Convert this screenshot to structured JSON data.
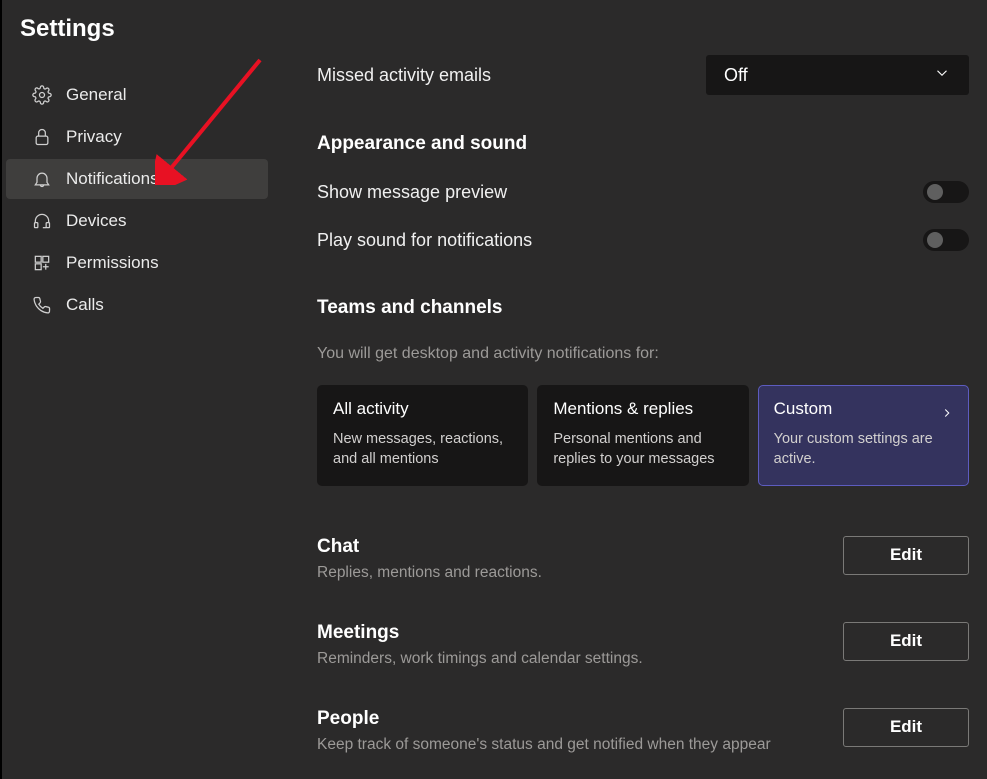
{
  "title": "Settings",
  "sidebar": {
    "items": [
      {
        "label": "General",
        "icon": "gear-icon"
      },
      {
        "label": "Privacy",
        "icon": "lock-icon"
      },
      {
        "label": "Notifications",
        "icon": "bell-icon"
      },
      {
        "label": "Devices",
        "icon": "headset-icon"
      },
      {
        "label": "Permissions",
        "icon": "apps-icon"
      },
      {
        "label": "Calls",
        "icon": "phone-icon"
      }
    ],
    "selected_index": 2
  },
  "content": {
    "missed_emails": {
      "label": "Missed activity emails",
      "value": "Off"
    },
    "appearance": {
      "heading": "Appearance and sound",
      "preview_label": "Show message preview",
      "preview_on": false,
      "sound_label": "Play sound for notifications",
      "sound_on": false
    },
    "teams": {
      "heading": "Teams and channels",
      "subtext": "You will get desktop and activity notifications for:",
      "cards": [
        {
          "title": "All activity",
          "desc": "New messages, reactions, and all mentions"
        },
        {
          "title": "Mentions & replies",
          "desc": "Personal mentions and replies to your messages"
        },
        {
          "title": "Custom",
          "desc": "Your custom settings are active."
        }
      ],
      "selected_card": 2
    },
    "chat": {
      "title": "Chat",
      "desc": "Replies, mentions and reactions.",
      "button": "Edit"
    },
    "meetings": {
      "title": "Meetings",
      "desc": "Reminders, work timings and calendar settings.",
      "button": "Edit"
    },
    "people": {
      "title": "People",
      "desc": "Keep track of someone's status and get notified when they appear",
      "button": "Edit"
    }
  }
}
